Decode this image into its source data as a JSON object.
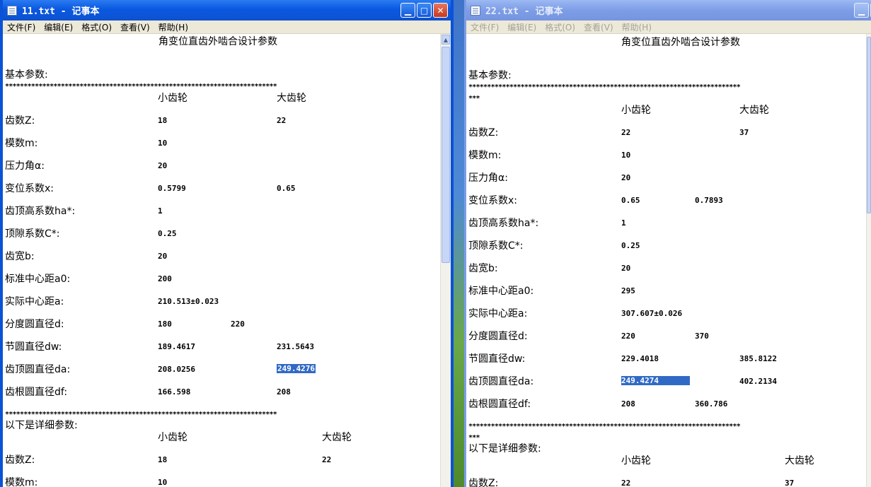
{
  "windows": {
    "left": {
      "title": "11.txt - 记事本",
      "menu": [
        "文件(F)",
        "编辑(E)",
        "格式(O)",
        "查看(V)",
        "帮助(H)"
      ],
      "doc_title": "角变位直齿外啮合设计参数",
      "section_basic": "基本参数:",
      "stars_line": "*************************************************************************",
      "col_small": "小齿轮",
      "col_large": "大齿轮",
      "rows": [
        {
          "label": "齿数Z:",
          "v1": "18",
          "v2": "22"
        },
        {
          "label": "模数m:",
          "v1": "10"
        },
        {
          "label": "压力角α:",
          "v1": "20"
        },
        {
          "label": "变位系数x:",
          "v1": "0.5799",
          "v2": "0.65"
        },
        {
          "label": "齿顶高系数ha*:",
          "v1": "1"
        },
        {
          "label": "顶隙系数C*:",
          "v1": "0.25"
        },
        {
          "label": "齿宽b:",
          "v1": "20"
        },
        {
          "label": "标准中心距a0:",
          "v1": "200"
        },
        {
          "label": "实际中心距a:",
          "v1": "210.513±0.023"
        },
        {
          "label": "分度圆直径d:",
          "v1": "180",
          "v2": "220"
        },
        {
          "label": "节圆直径dw:",
          "v1": "189.4617",
          "v2": "231.5643"
        },
        {
          "label": "齿顶圆直径da:",
          "v1": "208.0256",
          "v2": "249.4276"
        },
        {
          "label": "齿根圆直径df:",
          "v1": "166.598",
          "v2": "208"
        }
      ],
      "section_detail": "以下是详细参数:",
      "detail_col_small": "小齿轮",
      "detail_col_large": "大齿轮",
      "detail_rows": [
        {
          "label": "齿数Z:",
          "v1": "18",
          "v2": "22"
        },
        {
          "label": "模数m:",
          "v1": "10"
        }
      ]
    },
    "right": {
      "title": "22.txt - 记事本",
      "menu": [
        "文件(F)",
        "编辑(E)",
        "格式(O)",
        "查看(V)",
        "帮助(H)"
      ],
      "doc_title": "角变位直齿外啮合设计参数",
      "section_basic": "基本参数:",
      "stars_line": "*************************************************************************",
      "stars_wrap": "***",
      "col_small": "小齿轮",
      "col_large": "大齿轮",
      "rows": [
        {
          "label": "齿数Z:",
          "v1": "22",
          "v2": "37"
        },
        {
          "label": "模数m:",
          "v1": "10"
        },
        {
          "label": "压力角α:",
          "v1": "20"
        },
        {
          "label": "变位系数x:",
          "v1": "0.65",
          "v2": "0.7893"
        },
        {
          "label": "齿顶高系数ha*:",
          "v1": "1"
        },
        {
          "label": "顶隙系数C*:",
          "v1": "0.25"
        },
        {
          "label": "齿宽b:",
          "v1": "20"
        },
        {
          "label": "标准中心距a0:",
          "v1": "295"
        },
        {
          "label": "实际中心距a:",
          "v1": "307.607±0.026"
        },
        {
          "label": "分度圆直径d:",
          "v1": "220",
          "v2": "370"
        },
        {
          "label": "节圆直径dw:",
          "v1": "229.4018",
          "v2": "385.8122"
        },
        {
          "label": "齿顶圆直径da:",
          "v1": "249.4274",
          "v2": "402.2134"
        },
        {
          "label": "齿根圆直径df:",
          "v1": "208",
          "v2": "360.786"
        }
      ],
      "section_detail": "以下是详细参数:",
      "detail_col_small": "小齿轮",
      "detail_col_large": "大齿轮",
      "detail_rows": [
        {
          "label": "齿数Z:",
          "v1": "22",
          "v2": "37"
        }
      ]
    }
  }
}
